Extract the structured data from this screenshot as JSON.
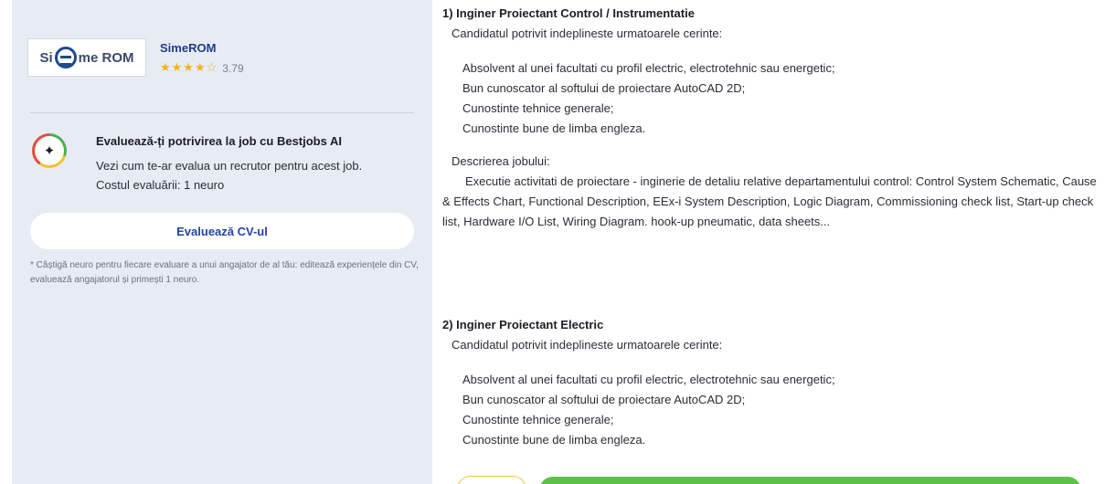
{
  "sidebar": {
    "company": {
      "logo_text": "Si me ROM",
      "name": "SimeROM",
      "stars": 4,
      "stars_text": "★★★★",
      "star_empty_text": "☆",
      "rating": "3.79"
    },
    "ai": {
      "title": "Evaluează-ți potrivirea la job cu Bestjobs AI",
      "desc_line1": "Vezi cum te-ar evalua un recrutor pentru acest job.",
      "desc_line2": "Costul evaluării: 1 neuro"
    },
    "evaluate_button": "Evaluează CV-ul",
    "footnote": "* Câștigă neuro pentru fiecare evaluare a unui angajator de al tău: editează experiențele din CV, evaluează angajatorul și primești 1 neuro."
  },
  "jobs": [
    {
      "title": "1) Inginer Proiectant Control / Instrumentatie",
      "intro": "Candidatul potrivit indeplineste urmatoarele cerinte:",
      "requirements": [
        "Absolvent al unei facultati cu profil electric, electrotehnic sau energetic;",
        "Bun cunoscator al softului de proiectare AutoCAD 2D;",
        "Cunostinte tehnice generale;",
        "Cunostinte bune de limba engleza."
      ],
      "desc_label": "Descrierea jobului:",
      "desc": "Executie activitati de proiectare - inginerie de detaliu relative departamentului control: Control System Schematic, Cause & Effects Chart, Functional Description, EEx-i System Description, Logic Diagram, Commissioning check list, Start-up check list, Hardware I/O List, Wiring Diagram. hook-up pneumatic, data sheets..."
    },
    {
      "title": "2) Inginer Proiectant Electric",
      "intro": "Candidatul potrivit indeplineste urmatoarele cerinte:",
      "requirements": [
        "Absolvent al unei facultati cu profil electric, electrotehnic sau energetic;",
        "Bun cunoscator al softului de proiectare AutoCAD 2D;",
        "Cunostinte tehnice generale;",
        "Cunostinte bune de limba engleza."
      ]
    }
  ],
  "colors": {
    "sidebar_bg": "#e7ebf4",
    "brand_blue": "#1f3b8a",
    "star": "#f5b21a",
    "apply_green": "#5cc14a",
    "save_border": "#f0c640"
  }
}
